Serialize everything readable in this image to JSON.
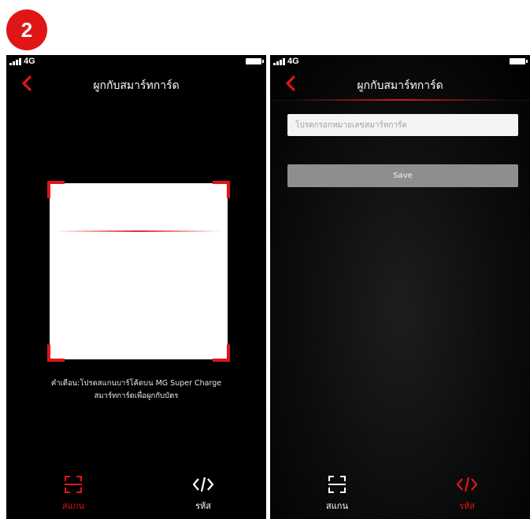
{
  "step_badge": "2",
  "left_screen": {
    "status": {
      "network": "4G"
    },
    "title": "ผูกกับสมาร์ทการ์ด",
    "hint_line1": "คำเตือน:โปรดสแกนบาร์โค้ดบน MG Super Charge",
    "hint_line2": "สมาร์ทการ์ดเพื่อผูกกับบัตร",
    "tabs": [
      {
        "label": "สแกน",
        "icon": "scan-icon",
        "active": true
      },
      {
        "label": "รหัส",
        "icon": "code-icon",
        "active": false
      }
    ]
  },
  "right_screen": {
    "status": {
      "network": "4G"
    },
    "title": "ผูกกับสมาร์ทการ์ด",
    "card_input": {
      "placeholder": "โปรดกรอกหมายเลขสมาร์ทการ์ด",
      "value": ""
    },
    "save_label": "Save",
    "tabs": [
      {
        "label": "สแกน",
        "icon": "scan-icon",
        "active": false
      },
      {
        "label": "รหัส",
        "icon": "code-icon",
        "active": true
      }
    ]
  },
  "colors": {
    "accent": "#e01616",
    "background": "#000000",
    "button": "#8e8e8e",
    "input": "#f4f4f4"
  }
}
